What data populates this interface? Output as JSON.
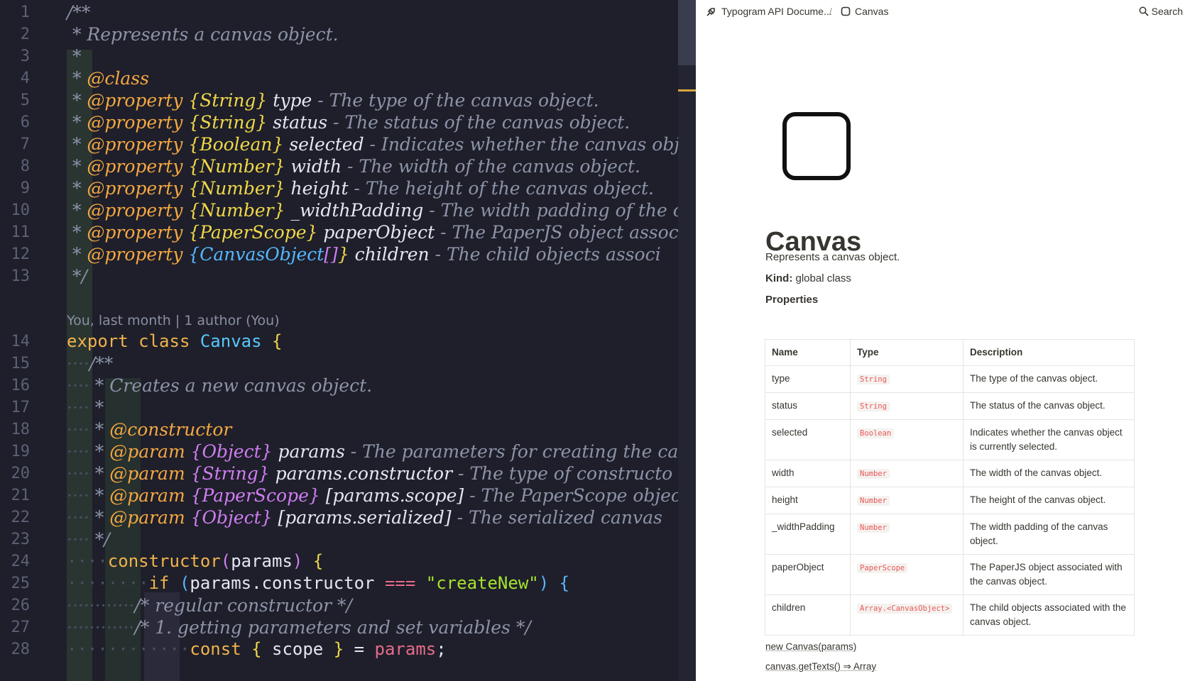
{
  "editor": {
    "line_numbers": [
      "1",
      "2",
      "3",
      "4",
      "5",
      "6",
      "7",
      "8",
      "9",
      "10",
      "11",
      "12",
      "13",
      "14",
      "15",
      "16",
      "17",
      "18",
      "19",
      "20",
      "21",
      "22",
      "23",
      "24",
      "25",
      "26",
      "27",
      "28"
    ],
    "blame": "You, last month | 1 author (You)",
    "l1": "/**",
    "l2": "* Represents a canvas object.",
    "l3": "*",
    "l4_star": "* ",
    "l4_tag": "@class",
    "props": [
      {
        "tag": "@property",
        "type": "{String}",
        "name": "type",
        "desc": " - The type of the canvas object."
      },
      {
        "tag": "@property",
        "type": "{String}",
        "name": "status",
        "desc": " - The status of the canvas object."
      },
      {
        "tag": "@property",
        "type": "{Boolean}",
        "name": "selected",
        "desc": " - Indicates whether the canvas obj"
      },
      {
        "tag": "@property",
        "type": "{Number}",
        "name": "width",
        "desc": " - The width of the canvas object."
      },
      {
        "tag": "@property",
        "type": "{Number}",
        "name": "height",
        "desc": " - The height of the canvas object."
      },
      {
        "tag": "@property",
        "type": "{Number}",
        "name": "_widthPadding",
        "desc": " - The width padding of the car"
      },
      {
        "tag": "@property",
        "type": "{PaperScope}",
        "name": "paperObject",
        "desc": " - The PaperJS object associ"
      },
      {
        "tag": "@property",
        "type": "{CanvasObject",
        "type_arr": "[]",
        "type_close": "}",
        "name": "children",
        "desc": " - The child objects associ"
      }
    ],
    "l13": "*/",
    "l14_kw1": "export",
    "l14_kw2": "class",
    "l14_name": "Canvas",
    "l14_brace": "{",
    "l15": "/**",
    "l16": "* Creates a new canvas object.",
    "l17": "*",
    "l18_star": "* ",
    "l18_tag": "@constructor",
    "params": [
      {
        "tag": "@param",
        "type": "{Object}",
        "name": "params",
        "desc": " - The parameters for creating the ca"
      },
      {
        "tag": "@param",
        "type": "{String}",
        "name": "params.constructor",
        "desc": " - The type of constructo"
      },
      {
        "tag": "@param",
        "type": "{PaperScope}",
        "name": "[params.scope]",
        "desc": " - The PaperScope object"
      },
      {
        "tag": "@param",
        "type": "{Object}",
        "name": "[params.serialized]",
        "desc": " - The serialized canvas"
      }
    ],
    "l23": "*/",
    "l24_fn": "constructor",
    "l24_p1": "(",
    "l24_arg": "params",
    "l24_p2": ")",
    "l24_brace": "{",
    "l25_kw": "if",
    "l25_p1": "(",
    "l25_a": "params",
    "l25_dot": ".",
    "l25_b": "constructor",
    "l25_op": "===",
    "l25_str": "\"createNew\"",
    "l25_p2": ")",
    "l25_brace": "{",
    "l26": "/* regular constructor */",
    "l27": "/* 1. getting parameters and set variables */",
    "l28_kw": "const",
    "l28_b1": "{",
    "l28_v": "scope",
    "l28_b2": "}",
    "l28_eq": "=",
    "l28_r": "params",
    "l28_semi": ";",
    "colors": {
      "background": "#1e1f2a",
      "tag": "#f5a742",
      "type": "#57b6ff",
      "brace": "#f0d84a",
      "string": "#a6e22e"
    }
  },
  "docs": {
    "breadcrumb": {
      "workspace": "Typogram API Docume...",
      "separator": "/",
      "page": "Canvas"
    },
    "search_label": "Search",
    "title": "Canvas",
    "description": "Represents a canvas object.",
    "kind_label": "Kind:",
    "kind_value": "global class",
    "properties_heading": "Properties",
    "table": {
      "headers": [
        "Name",
        "Type",
        "Description"
      ],
      "rows": [
        {
          "name": "type",
          "type": "String",
          "desc": "The type of the canvas object."
        },
        {
          "name": "status",
          "type": "String",
          "desc": "The status of the canvas object."
        },
        {
          "name": "selected",
          "type": "Boolean",
          "desc": "Indicates whether the canvas object is currently selected."
        },
        {
          "name": "width",
          "type": "Number",
          "desc": "The width of the canvas object."
        },
        {
          "name": "height",
          "type": "Number",
          "desc": "The height of the canvas object."
        },
        {
          "name": "_widthPadding",
          "type": "Number",
          "desc": "The width padding of the canvas object."
        },
        {
          "name": "paperObject",
          "type": "PaperScope",
          "desc": "The PaperJS object associated with the canvas object."
        },
        {
          "name": "children",
          "type": "Array.<CanvasObject>",
          "desc": "The child objects associated with the canvas object."
        }
      ]
    },
    "links": [
      "new Canvas(params)",
      "canvas.getTexts() ⇒ Array"
    ]
  }
}
